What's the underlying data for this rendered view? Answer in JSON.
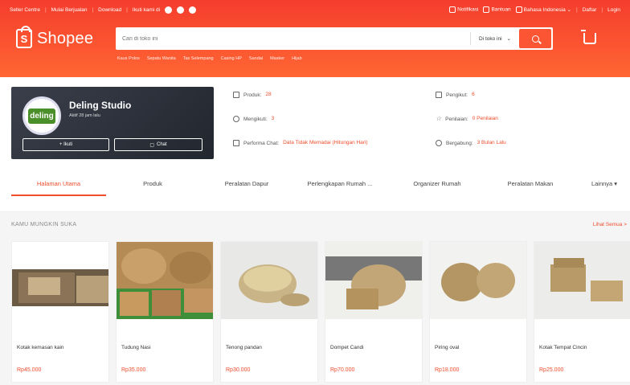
{
  "topbar": {
    "left": [
      "Seller Centre",
      "Mulai Berjualan",
      "Download",
      "Ikuti kami di"
    ],
    "right": [
      "Notifikasi",
      "Bantuan",
      "Bahasa Indonesia",
      "Daftar",
      "Login"
    ]
  },
  "logo": {
    "text": "Shopee"
  },
  "search": {
    "placeholder": "Cari di toko ini",
    "scope": "Di toko ini"
  },
  "suggestions": [
    "Kaus Polos",
    "Sepatu Wanita",
    "Tas Selempang",
    "Casing HP",
    "Sandal",
    "Masker",
    "Hijab"
  ],
  "shop": {
    "name": "Deling Studio",
    "active": "Aktif 28 jam lalu",
    "logo_text": "deling",
    "follow_label": "+ Ikuti",
    "chat_label": "Chat"
  },
  "stats": {
    "left": [
      {
        "label": "Produk:",
        "value": "28"
      },
      {
        "label": "Mengikuti:",
        "value": "3"
      },
      {
        "label": "Performa Chat:",
        "value": "Data Tidak Memadai (Hitungan Hari)"
      }
    ],
    "right": [
      {
        "label": "Pengikut:",
        "value": "6"
      },
      {
        "label": "Penilaian:",
        "value": "0 Penilaian"
      },
      {
        "label": "Bergabung:",
        "value": "3 Bulan Lalu"
      }
    ]
  },
  "tabs": [
    {
      "label": "Halaman Utama"
    },
    {
      "label": "Produk"
    },
    {
      "label": "Peralatan Dapur"
    },
    {
      "label": "Perlengkapan Rumah ..."
    },
    {
      "label": "Organizer Rumah"
    },
    {
      "label": "Peralatan Makan"
    },
    {
      "label": "Lainnya ▾"
    }
  ],
  "section": {
    "title": "KAMU MUNGKIN SUKA",
    "see_all": "Lihat Semua >"
  },
  "products": [
    {
      "name": "Kotak kemasan kain",
      "price": "Rp45.000"
    },
    {
      "name": "Tudung Nasi",
      "price": "Rp35.000"
    },
    {
      "name": "Tenong pandan",
      "price": "Rp30.000"
    },
    {
      "name": "Dompet Candi",
      "price": "Rp70.000"
    },
    {
      "name": "Piring oval",
      "price": "Rp18.000"
    },
    {
      "name": "Kotak Tempat Cincin",
      "price": "Rp25.000"
    }
  ],
  "colors": {
    "brand": "#ee4d2d",
    "header": "#f53d2d",
    "card": "#2d313a"
  }
}
